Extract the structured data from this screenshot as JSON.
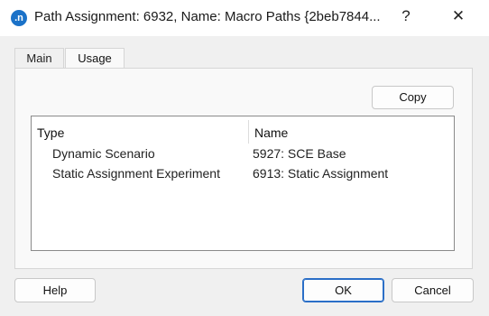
{
  "window": {
    "title": "Path Assignment: 6932, Name: Macro Paths  {2beb7844...",
    "app_icon_glyph": ".n",
    "help_glyph": "?",
    "close_glyph": "✕"
  },
  "tabs": [
    {
      "label": "Main",
      "selected": false
    },
    {
      "label": "Usage",
      "selected": true
    }
  ],
  "usage": {
    "copy_label": "Copy",
    "columns": [
      "Type",
      "Name"
    ],
    "rows": [
      {
        "type": "Dynamic Scenario",
        "name": "5927: SCE Base"
      },
      {
        "type": "Static Assignment Experiment",
        "name": "6913: Static Assignment"
      }
    ]
  },
  "footer": {
    "help_label": "Help",
    "ok_label": "OK",
    "cancel_label": "Cancel"
  },
  "colors": {
    "accent": "#2b6fc7",
    "app_icon": "#1b72c8"
  }
}
